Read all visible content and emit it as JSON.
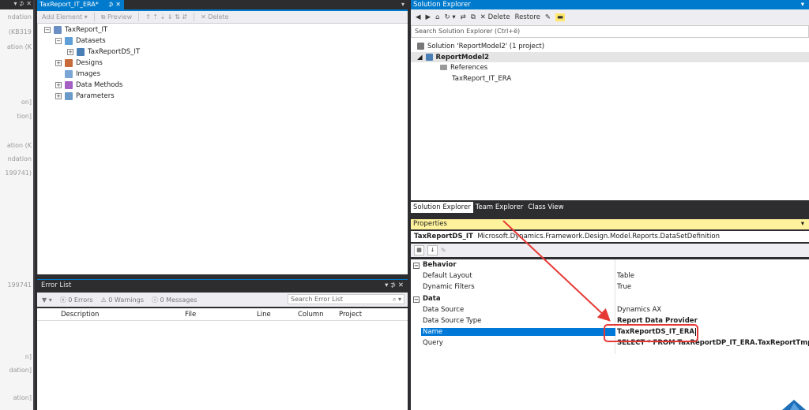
{
  "left_panel": {
    "fragments": [
      "ndation",
      "(KB319",
      "ation (K",
      "on]",
      "tion]",
      "ation (K",
      "ndation",
      "199741)",
      "199741",
      "n]",
      "dation]",
      "ation]"
    ]
  },
  "document": {
    "tab_label": "TaxReport_IT_ERA*",
    "toolbar": {
      "add_element": "Add Element",
      "preview": "Preview",
      "delete": "Delete"
    },
    "tree": {
      "root": "TaxReport_IT",
      "datasets": "Datasets",
      "dataset_item": "TaxReportDS_IT",
      "designs": "Designs",
      "images": "Images",
      "data_methods": "Data Methods",
      "parameters": "Parameters"
    }
  },
  "error_list": {
    "title": "Error List",
    "errors": "0 Errors",
    "warnings": "0 Warnings",
    "messages": "0 Messages",
    "search_placeholder": "Search Error List",
    "columns": [
      "Description",
      "File",
      "Line",
      "Column",
      "Project"
    ]
  },
  "solution_explorer": {
    "title": "Solution Explorer",
    "toolbar": {
      "delete": "Delete",
      "restore": "Restore"
    },
    "search_placeholder": "Search Solution Explorer (Ctrl+ë)",
    "solution": "Solution 'ReportModel2' (1 project)",
    "project": "ReportModel2",
    "references": "References",
    "item": "TaxReport_IT_ERA",
    "tabs": [
      "Solution Explorer",
      "Team Explorer",
      "Class View"
    ]
  },
  "properties": {
    "title": "Properties",
    "object_name": "TaxReportDS_IT",
    "object_type": "Microsoft.Dynamics.Framework.Design.Model.Reports.DataSetDefinition",
    "categories": [
      {
        "name": "Behavior",
        "rows": [
          {
            "key": "Default Layout",
            "value": "Table"
          },
          {
            "key": "Dynamic Filters",
            "value": "True"
          }
        ]
      },
      {
        "name": "Data",
        "rows": [
          {
            "key": "Data Source",
            "value": "Dynamics AX"
          },
          {
            "key": "Data Source Type",
            "value": "Report Data Provider"
          },
          {
            "key": "Name",
            "value": "TaxReportDS_IT_ERA"
          },
          {
            "key": "Query",
            "value": "SELECT * FROM TaxReportDP_IT_ERA.TaxReportTmp_IT"
          }
        ]
      }
    ]
  },
  "colors": {
    "accent": "#007acc",
    "chrome": "#2d2d30",
    "annotation": "#e53935",
    "properties_header": "#fff29d"
  }
}
